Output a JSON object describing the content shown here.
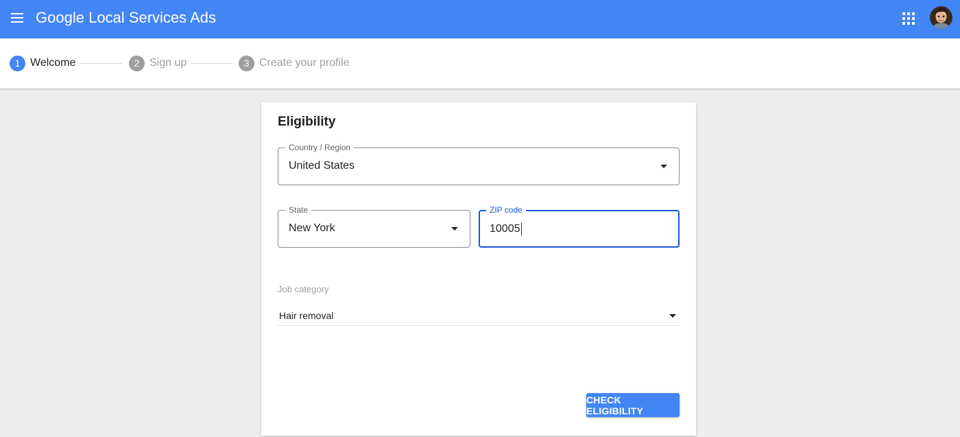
{
  "appbar": {
    "menu_icon": "hamburger-menu-icon",
    "brand_google": "Google",
    "brand_product": "Local Services Ads",
    "apps_icon": "apps-grid-icon",
    "avatar_icon": "user-avatar",
    "color": "#4285f4"
  },
  "stepper": {
    "steps": [
      {
        "number": "1",
        "label": "Welcome",
        "state": "active"
      },
      {
        "number": "2",
        "label": "Sign up",
        "state": "inactive"
      },
      {
        "number": "3",
        "label": "Create your profile",
        "state": "inactive"
      }
    ]
  },
  "form": {
    "title": "Eligibility",
    "country": {
      "label": "Country / Region",
      "value": "United States",
      "icon": "dropdown-arrow-icon"
    },
    "state": {
      "label": "State",
      "value": "New York",
      "icon": "dropdown-arrow-icon"
    },
    "zip": {
      "label": "ZIP code",
      "value": "10005",
      "focused": true
    },
    "job_category": {
      "label": "Job category",
      "value": "Hair removal",
      "icon": "dropdown-arrow-icon"
    },
    "submit_label": "CHECK ELIGIBILITY"
  },
  "colors": {
    "primary": "#4285f4",
    "focus": "#1a56d6",
    "inactive_step": "#9e9e9e",
    "page_background": "#ededed"
  }
}
